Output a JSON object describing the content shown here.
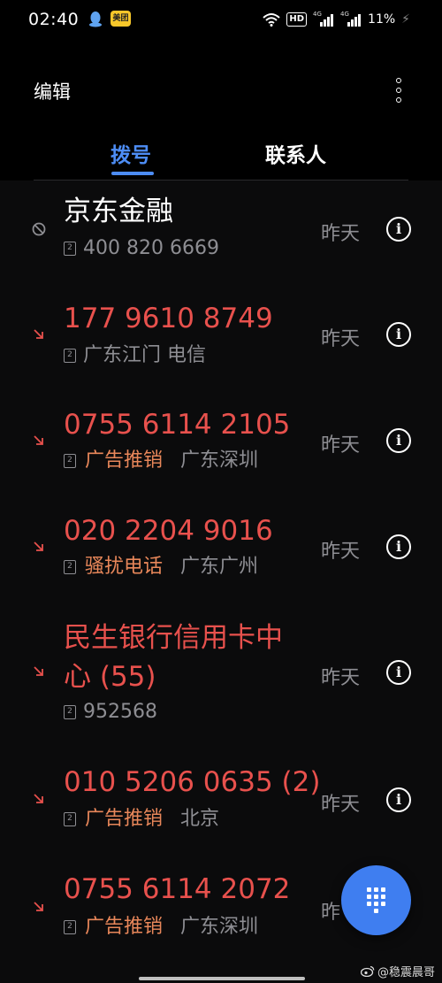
{
  "status_bar": {
    "time": "02:40",
    "app_badge": "美团",
    "hd_label": "HD",
    "signal_label_1": "4G",
    "signal_label_2": "4G",
    "battery": "11%"
  },
  "header": {
    "edit_label": "编辑",
    "tabs": [
      {
        "label": "拨号",
        "active": true
      },
      {
        "label": "联系人",
        "active": false
      }
    ]
  },
  "colors": {
    "accent": "#4d8df5",
    "missed": "#e8514d",
    "tag": "#e8875a",
    "muted": "#8e8e93",
    "background": "#0b0b0c",
    "fab": "#3f7ef0"
  },
  "calls": [
    {
      "name": "京东金融",
      "type": "blocked",
      "sim": "2",
      "number": "400 820 6669",
      "tag": "",
      "location": "",
      "date": "昨天"
    },
    {
      "name": "177 9610 8749",
      "type": "missed",
      "sim": "2",
      "number": "",
      "tag": "",
      "location": "广东江门 电信",
      "date": "昨天"
    },
    {
      "name": "0755 6114 2105",
      "type": "missed",
      "sim": "2",
      "number": "",
      "tag": "广告推销",
      "location": "广东深圳",
      "date": "昨天"
    },
    {
      "name": "020 2204 9016",
      "type": "missed",
      "sim": "2",
      "number": "",
      "tag": "骚扰电话",
      "location": "广东广州",
      "date": "昨天"
    },
    {
      "name_line1": "民生银行信用卡中",
      "name_line2": "心 (55)",
      "type": "missed",
      "sim": "2",
      "number": "952568",
      "tag": "",
      "location": "",
      "date": "昨天"
    },
    {
      "name": "010 5206 0635 (2)",
      "type": "missed",
      "sim": "2",
      "number": "",
      "tag": "广告推销",
      "location": "北京",
      "date": "昨天"
    },
    {
      "name": "0755 6114 2072",
      "type": "missed",
      "sim": "2",
      "number": "",
      "tag": "广告推销",
      "location": "广东深圳",
      "date": "昨"
    }
  ],
  "watermark": "@稳震晨哥"
}
